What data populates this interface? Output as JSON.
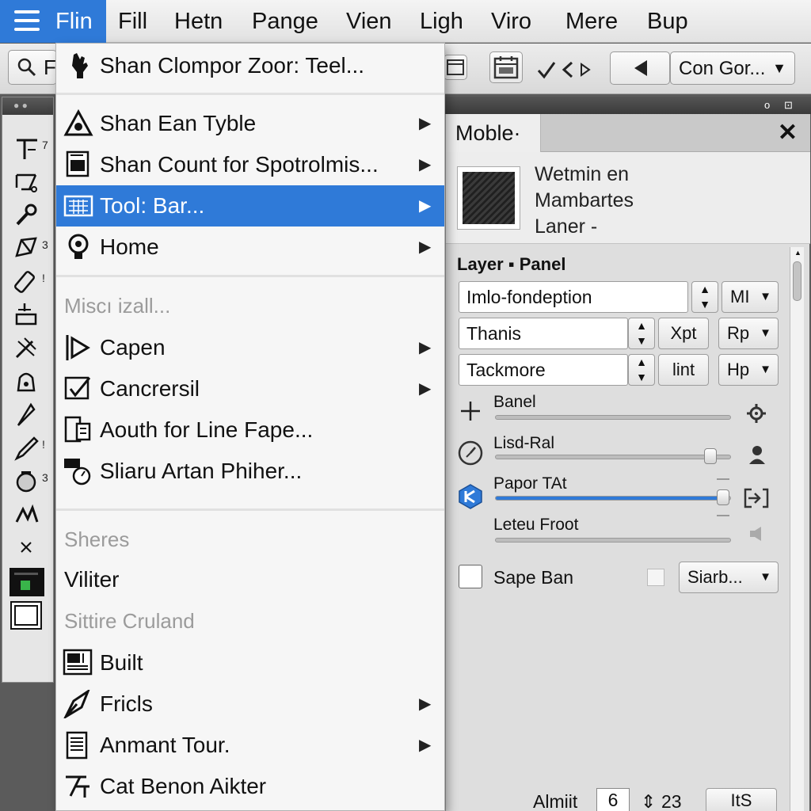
{
  "menubar": {
    "active": "Flin",
    "items": [
      "Fill",
      "Hetn",
      "Pange",
      "Vien",
      "Ligh",
      "Viro",
      "Mere",
      "Bup"
    ]
  },
  "toolbar": {
    "search_letter": "F",
    "combo_value": "Con Gor..."
  },
  "menu": {
    "top_item": "Shan Clompor Zoor: Teel...",
    "group1": [
      "Shan Ean Tyble",
      "Shan Count for Spotrolmis...",
      "Tool: Bar...",
      "Home"
    ],
    "misc_header": "Miscı izall...",
    "group2": [
      "Capen",
      "Cancrersil",
      "Aouth for Line Fape...",
      "Sliaru Artan Phiher..."
    ],
    "sheres_header": "Sheres",
    "viliter": "Viliter",
    "sittire_header": "Sittire Cruland",
    "group3": [
      "Built",
      "Fricls",
      "Anmant Tour.",
      "Cat Benon Aikter"
    ]
  },
  "palette": {
    "subs": [
      "7",
      "",
      "",
      "3",
      "!",
      "",
      "",
      "",
      "",
      "!",
      "3",
      "",
      "",
      "",
      "",
      ""
    ]
  },
  "panel": {
    "tab": "Moble·",
    "close": "✕",
    "header_lines": [
      "Wetmin en",
      "Mambartes",
      "Laner ‐"
    ],
    "section_title": "Layer ▪ Panel",
    "rows": [
      {
        "field": "Imlo-fondeption",
        "btn": "",
        "dd": "MI"
      },
      {
        "field": "Thanis",
        "btn": "Xpt",
        "dd": "Rp"
      },
      {
        "field": "Tackmore",
        "btn": "lint",
        "dd": "Hp"
      }
    ],
    "sliders": [
      {
        "label": "Banel",
        "value": 0
      },
      {
        "label": "Lisd-Ral",
        "value": 0.92
      },
      {
        "label": "Papor TAt",
        "value": 0.97
      },
      {
        "label": "Leteu Froot",
        "value": 0
      }
    ],
    "checkbox_label": "Sape Ban",
    "checkbox_dd": "Siarb...",
    "status_label": "Almiit",
    "status_value": "6",
    "status_num": "23",
    "status_btn": "ItS"
  },
  "colors": {
    "accent": "#2f7ad8",
    "panel": "#dedede",
    "menu": "#f6f6f6"
  }
}
